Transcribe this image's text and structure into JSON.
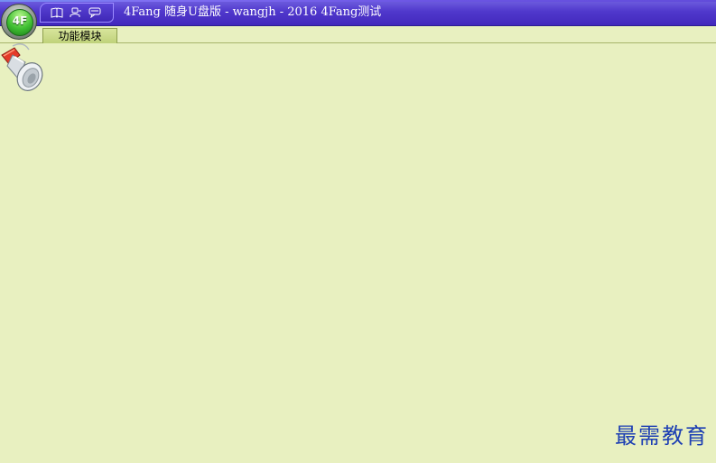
{
  "window": {
    "title": "4Fang 随身U盘版  - wangjh - 2016 4Fang测试"
  },
  "app_orb": {
    "label": "4F"
  },
  "quick_access": {
    "items": [
      {
        "icon": "book-icon"
      },
      {
        "icon": "user-icon"
      },
      {
        "icon": "chat-icon"
      }
    ]
  },
  "ribbon": {
    "tabs": [
      {
        "label": "功能模块",
        "active": true
      }
    ]
  },
  "workspace": {
    "icon": "megaphone-icon"
  },
  "watermark": {
    "text": "最需教育"
  },
  "colors": {
    "title_bar": "#4a32c8",
    "workspace_bg": "#e8f0c0",
    "tab_bg": "#c8d88a",
    "watermark": "#1d3fb3"
  }
}
